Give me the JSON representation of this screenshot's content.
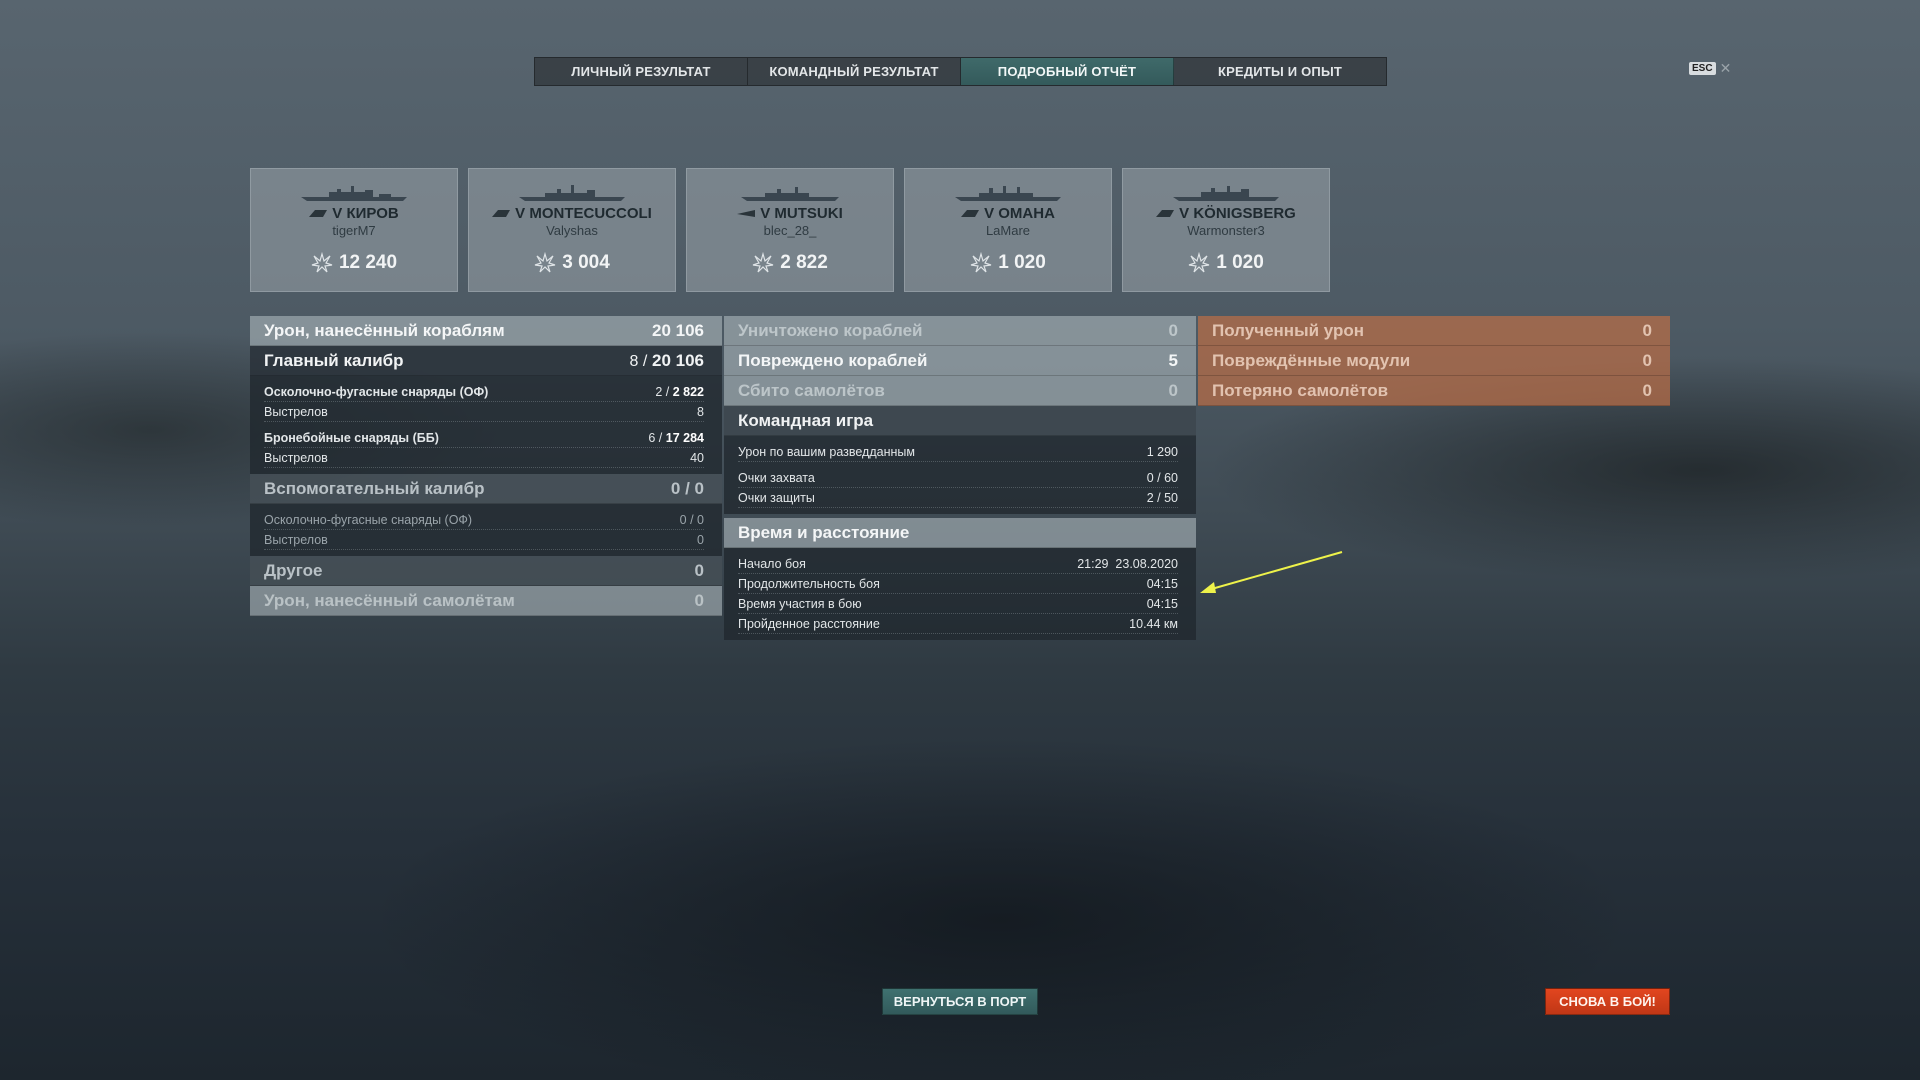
{
  "tabs": [
    {
      "label": "ЛИЧНЫЙ РЕЗУЛЬТАТ",
      "active": false
    },
    {
      "label": "КОМАНДНЫЙ РЕЗУЛЬТАТ",
      "active": false
    },
    {
      "label": "ПОДРОБНЫЙ ОТЧЁТ",
      "active": true
    },
    {
      "label": "КРЕДИТЫ И ОПЫТ",
      "active": false
    }
  ],
  "esc_label": "ESC",
  "ships": [
    {
      "name": "V КИРОВ",
      "player": "tigerM7",
      "damage": "12 240"
    },
    {
      "name": "V MONTECUCCOLI",
      "player": "Valyshas",
      "damage": "3 004"
    },
    {
      "name": "V MUTSUKI",
      "player": "blec_28_",
      "damage": "2 822"
    },
    {
      "name": "V OMAHA",
      "player": "LaMare",
      "damage": "1 020"
    },
    {
      "name": "V KÖNIGSBERG",
      "player": "Warmonster3",
      "damage": "1 020"
    }
  ],
  "damage_col": {
    "ships_damage": {
      "label": "Урон, нанесённый кораблям",
      "value": "20 106"
    },
    "main_caliber": {
      "label": "Главный калибр",
      "hits": "8 /",
      "value": "20 106"
    },
    "he": {
      "label": "Осколочно-фугасные снаряды (ОФ)",
      "hits": "2 /",
      "value": "2 822"
    },
    "he_shots": {
      "label": "Выстрелов",
      "value": "8"
    },
    "ap": {
      "label": "Бронебойные снаряды (ББ)",
      "hits": "6 /",
      "value": "17 284"
    },
    "ap_shots": {
      "label": "Выстрелов",
      "value": "40"
    },
    "secondary": {
      "label": "Вспомогательный калибр",
      "value": "0 / 0"
    },
    "sec_he": {
      "label": "Осколочно-фугасные снаряды (ОФ)",
      "value": "0 / 0"
    },
    "sec_shots": {
      "label": "Выстрелов",
      "value": "0"
    },
    "other": {
      "label": "Другое",
      "value": "0"
    },
    "planes_damage": {
      "label": "Урон, нанесённый самолётам",
      "value": "0"
    }
  },
  "center_col": {
    "destroyed": {
      "label": "Уничтожено кораблей",
      "value": "0"
    },
    "damaged": {
      "label": "Повреждено кораблей",
      "value": "5"
    },
    "planes_shot": {
      "label": "Сбито самолётов",
      "value": "0"
    },
    "team_title": "Командная игра",
    "spotting": {
      "label": "Урон по вашим разведданным",
      "value": "1 290"
    },
    "capture": {
      "label": "Очки захвата",
      "value": "0 / 60"
    },
    "defense": {
      "label": "Очки защиты",
      "value": "2 / 50"
    },
    "time_title": "Время и расстояние",
    "start": {
      "label": "Начало боя",
      "value": "21:29  23.08.2020"
    },
    "duration": {
      "label": "Продолжительность боя",
      "value": "04:15"
    },
    "participation": {
      "label": "Время участия в бою",
      "value": "04:15"
    },
    "distance": {
      "label": "Пройденное расстояние",
      "value": "10.44 км"
    }
  },
  "received_col": {
    "received_damage": {
      "label": "Полученный урон",
      "value": "0"
    },
    "modules": {
      "label": "Повреждённые модули",
      "value": "0"
    },
    "planes_lost": {
      "label": "Потеряно самолётов",
      "value": "0"
    }
  },
  "buttons": {
    "port": "ВЕРНУТЬСЯ В ПОРТ",
    "fight": "СНОВА В БОЙ!"
  },
  "colors": {
    "accent_teal": "#3f6a6a",
    "fight_orange": "#d8401b",
    "received_panel": "#ba6e46",
    "arrow_yellow": "#eef24a"
  }
}
